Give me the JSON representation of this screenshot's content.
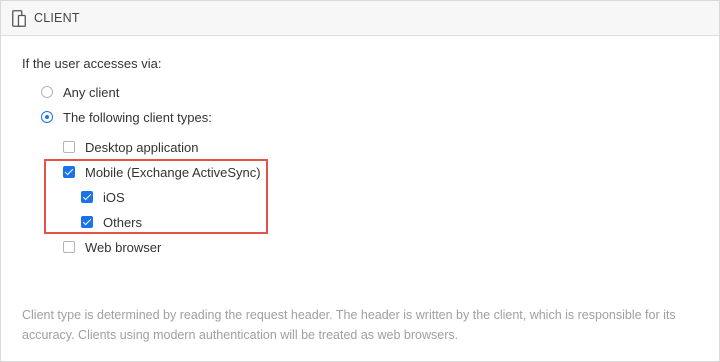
{
  "header": {
    "title": "CLIENT",
    "icon": "device-icon"
  },
  "question": "If the user accesses via:",
  "radio_options": [
    {
      "label": "Any client",
      "checked": false
    },
    {
      "label": "The following client types:",
      "checked": true
    }
  ],
  "client_types": {
    "desktop": {
      "label": "Desktop application",
      "checked": false
    },
    "mobile": {
      "label": "Mobile (Exchange ActiveSync)",
      "checked": true
    },
    "ios": {
      "label": "iOS",
      "checked": true
    },
    "others": {
      "label": "Others",
      "checked": true
    },
    "web": {
      "label": "Web browser",
      "checked": false
    }
  },
  "note": "Client type is determined by reading the request header. The header is written by the client, which is responsible for its accuracy. Clients using modern authentication will be treated as web browsers.",
  "colors": {
    "accent": "#1a73e8",
    "highlight": "#e55346"
  }
}
